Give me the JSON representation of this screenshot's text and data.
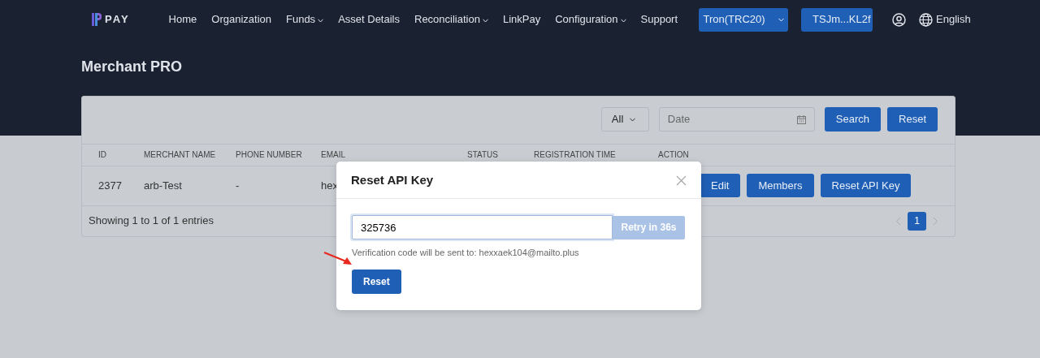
{
  "brand": {
    "name": "PAY"
  },
  "nav": [
    {
      "label": "Home",
      "dropdown": false
    },
    {
      "label": "Organization",
      "dropdown": false
    },
    {
      "label": "Funds",
      "dropdown": true
    },
    {
      "label": "Asset Details",
      "dropdown": false
    },
    {
      "label": "Reconciliation",
      "dropdown": true
    },
    {
      "label": "LinkPay",
      "dropdown": false
    },
    {
      "label": "Configuration",
      "dropdown": true
    },
    {
      "label": "Support",
      "dropdown": false
    }
  ],
  "network_button": {
    "label": "Tron(TRC20)"
  },
  "address_button": {
    "label": "TSJm...KL2f"
  },
  "language": {
    "label": "English"
  },
  "page_title": "Merchant PRO",
  "filters": {
    "status_select": "All",
    "date_placeholder": "Date",
    "buttons": [
      "Search",
      "Reset"
    ]
  },
  "table": {
    "columns": [
      "ID",
      "MERCHANT NAME",
      "PHONE NUMBER",
      "EMAIL",
      "STATUS",
      "REGISTRATION TIME",
      "ACTION"
    ],
    "rows": [
      {
        "cells": [
          "2377",
          "arb-Test",
          "-",
          "hex"
        ],
        "actions": [
          "Edit",
          "Members",
          "Reset API Key"
        ]
      }
    ]
  },
  "footer": {
    "summary": "Showing 1 to 1 of 1 entries",
    "pages": [
      {
        "label": "1",
        "selected": true
      }
    ]
  },
  "modal": {
    "title": "Reset API Key",
    "code_value": "325736",
    "retry_button": {
      "label": "Retry in 36s",
      "disabled": true
    },
    "hint": "Verification code will be sent to: hexxaek104@mailto.plus",
    "submit": "Reset"
  }
}
